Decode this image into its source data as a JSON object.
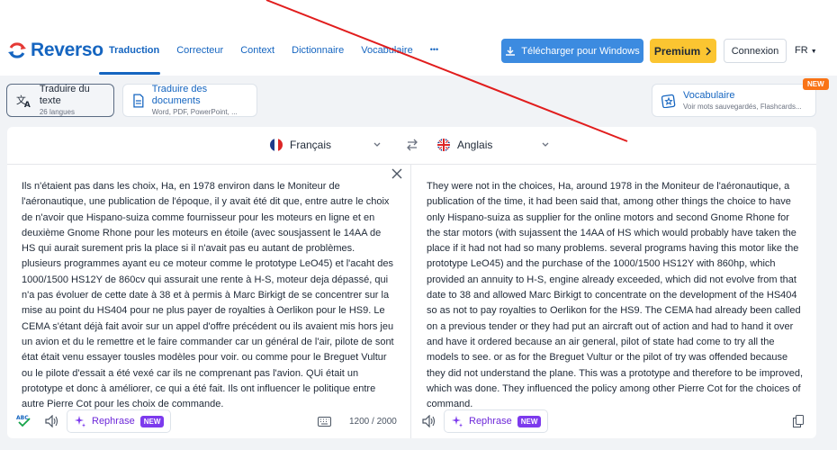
{
  "brand": {
    "name": "Reverso"
  },
  "nav": {
    "items": [
      "Traduction",
      "Correcteur",
      "Context",
      "Dictionnaire",
      "Vocabulaire",
      "•••"
    ]
  },
  "header": {
    "download_label": "Télécharger pour Windows",
    "premium_label": "Premium",
    "login_label": "Connexion",
    "ui_language": "FR"
  },
  "modes": {
    "text": {
      "title": "Traduire du texte",
      "subtitle": "26 langues"
    },
    "docs": {
      "title": "Traduire des documents",
      "subtitle": "Word, PDF, PowerPoint, ..."
    },
    "vocab": {
      "title": "Vocabulaire",
      "subtitle": "Voir mots sauvegardés, Flashcards...",
      "badge": "NEW"
    }
  },
  "translator": {
    "source_lang": "Français",
    "target_lang": "Anglais",
    "source_text": "Ils n'étaient pas dans les choix, Ha, en 1978 environ dans le Moniteur de l'aéronautique, une publication de l'époque, il y avait été dit que, entre autre le choix de n'avoir que Hispano-suiza comme fournisseur pour les moteurs en ligne et en deuxième Gnome Rhone pour les moteurs en étoile (avec sousjassent le 14AA de HS qui aurait surement pris la place si il n'avait pas eu autant de problèmes. plusieurs programmes ayant eu ce moteur comme le prototype LeO45) et l'acaht des 1000/1500 HS12Y de 860cv qui assurait une rente à H-S, moteur deja dépassé, qui n'a pas évoluer de cette date à 38 et à permis à Marc Birkigt de se concentrer sur la mise au point du HS404 pour ne plus payer de royalties à Oerlikon pour le HS9. Le CEMA s'étant déjà fait avoir sur un appel d'offre précédent ou ils avaient mis hors jeu un avion et du le remettre et le faire commander car un général de l'air, pilote de sont état était venu essayer tousles modèles pour voir. ou comme pour le Breguet Vultur ou le pilote d'essait a été vexé car ils ne comprenant pas l'avion. QUi était un prototype et donc à améliorer, ce qui a été fait. Ils ont influencer le politique entre autre Pierre Cot pour les choix de commande.",
    "target_text": "They were not in the choices, Ha, around 1978 in the Moniteur de l'aéronautique, a publication of the time, it had been said that, among other things the choice to have only Hispano-suiza as supplier for the online motors and second Gnome Rhone for the star motors (with sujassent the 14AA of HS which would probably have taken the place if it had not had so many problems. several programs having this motor like the prototype LeO45) and the purchase of the 1000/1500 HS12Y with 860hp, which provided an annuity to H-S, engine already exceeded, which did not evolve from that date to 38 and allowed Marc Birkigt to concentrate on the development of the HS404 so as not to pay royalties to Oerlikon for the HS9. The CEMA had already been called on a previous tender or they had put an aircraft out of action and had to hand it over and have it ordered because an air general, pilot of state had come to try all the models to see. or as for the Breguet Vultur or the pilot of try was offended because they did not understand the plane. This was a prototype and therefore to be improved, which was done. They influenced the policy among other Pierre Cot for the choices of command.",
    "rephrase_label": "Rephrase",
    "rephrase_badge": "NEW",
    "char_count": "1200 / 2000"
  },
  "colors": {
    "brand_blue": "#1565c0",
    "download_blue": "#3c8be0",
    "premium_yellow": "#fbc531",
    "new_orange": "#f97316",
    "rephrase_purple": "#7c3aed",
    "annotation_red": "#e11d1d"
  }
}
